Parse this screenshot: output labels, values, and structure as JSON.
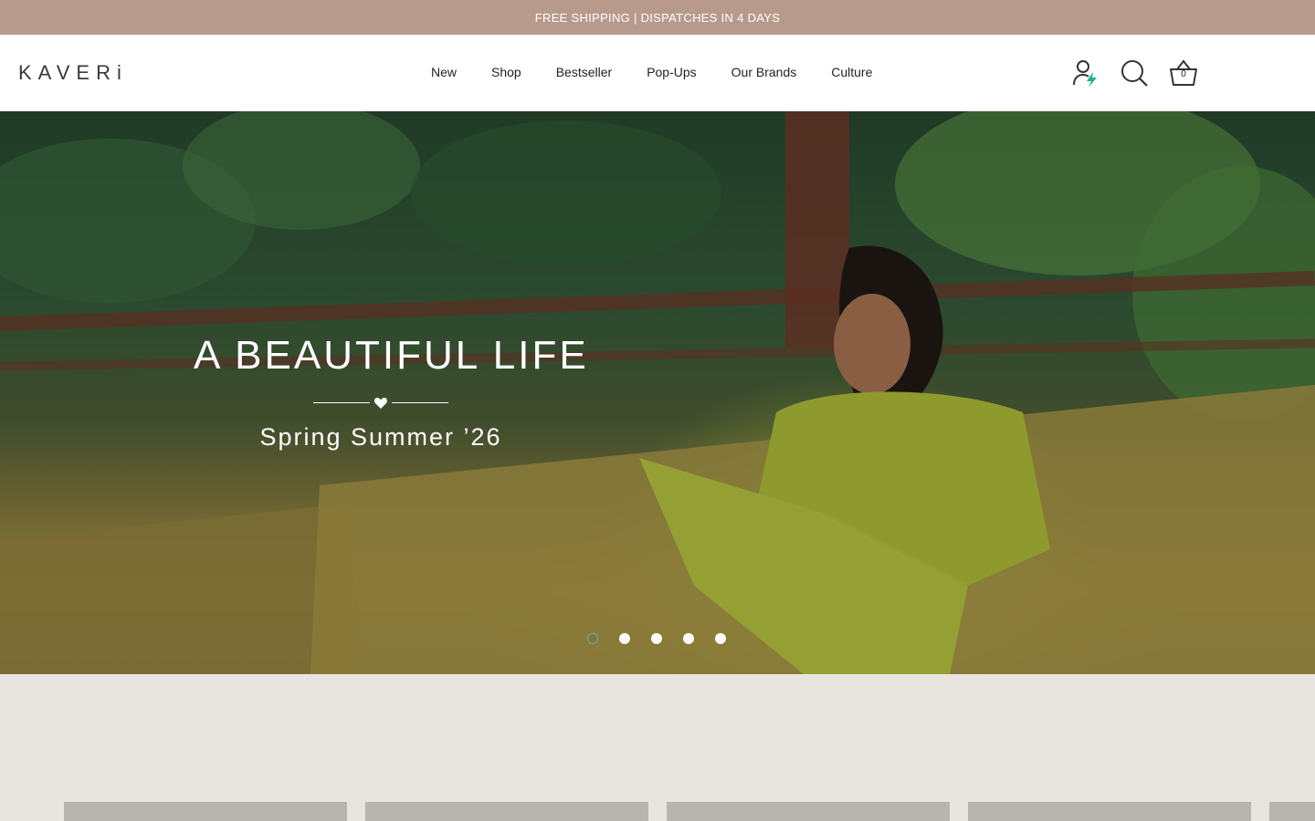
{
  "announcement": {
    "text": "FREE SHIPPING | DISPATCHES IN 4 DAYS"
  },
  "header": {
    "logo": "KAVERi",
    "nav": [
      "New",
      "Shop",
      "Bestseller",
      "Pop-Ups",
      "Our Brands",
      "Culture"
    ],
    "icons": {
      "account": "account-icon",
      "search": "search-icon",
      "cart": "basket-icon"
    },
    "cart_count": "0"
  },
  "hero": {
    "title": "A BEAUTIFUL LIFE",
    "subtitle": "Spring Summer ’26",
    "slides_total": 5,
    "active_slide": 1
  },
  "colors": {
    "announcement_bg": "#b89a8d",
    "page_bg": "#e8e5e1",
    "accent_green": "#1bb394"
  }
}
